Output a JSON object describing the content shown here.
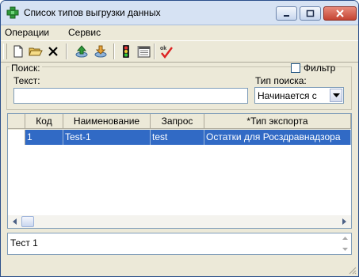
{
  "window": {
    "title": "Список типов выгрузки данных",
    "buttons": [
      "minimize",
      "maximize",
      "close"
    ]
  },
  "menu": {
    "items": [
      {
        "label": "Операции"
      },
      {
        "label": "Сервис"
      }
    ]
  },
  "toolbar": {
    "buttons": [
      {
        "icon": "new-document-icon"
      },
      {
        "icon": "open-folder-icon"
      },
      {
        "icon": "delete-icon"
      },
      {
        "icon": "upload-icon"
      },
      {
        "icon": "download-icon"
      },
      {
        "icon": "traffic-light-icon"
      },
      {
        "icon": "schedule-icon"
      },
      {
        "icon": "ok-check-icon"
      }
    ]
  },
  "search": {
    "group_label": "Поиск:",
    "text_label": "Текст:",
    "text_value": "",
    "filter_label": "Фильтр",
    "filter_checked": false,
    "type_label": "Тип поиска:",
    "type_value": "Начинается с"
  },
  "grid": {
    "columns": [
      "Код",
      "Наименование",
      "Запрос",
      "*Тип экспорта"
    ],
    "rows": [
      {
        "code": "1",
        "name": "Test-1",
        "query": "test",
        "export_type": "Остатки для Росздравнадзора",
        "selected": true
      }
    ]
  },
  "details": {
    "text": "Тест 1"
  },
  "colors": {
    "selection": "#316ac5",
    "titlebar": "#d6e2f3",
    "window_bg": "#ece9d8"
  }
}
